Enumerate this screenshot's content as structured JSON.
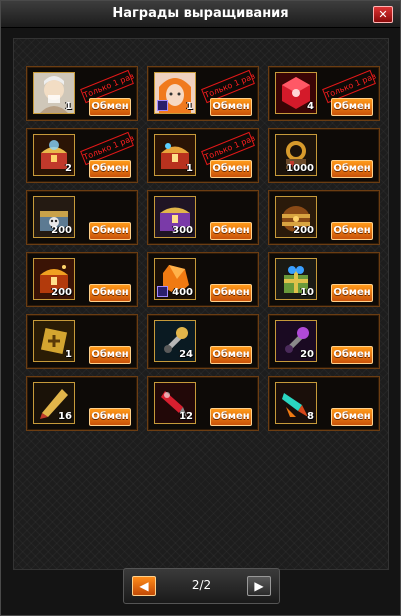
{
  "window": {
    "title": "Награды выращивания",
    "close_label": "✕"
  },
  "exchange_label": "Обмен",
  "once_label": "Только 1 раз",
  "rewards": [
    {
      "icon": "elder-portrait-icon",
      "qty": "1",
      "once": true
    },
    {
      "icon": "orange-hair-portrait-icon",
      "qty": "1",
      "once": true
    },
    {
      "icon": "red-cube-icon",
      "qty": "4",
      "once": true
    },
    {
      "icon": "gold-chest-icon",
      "qty": "2",
      "once": true
    },
    {
      "icon": "treasure-chest-icon",
      "qty": "1",
      "once": true
    },
    {
      "icon": "gear-bundle-icon",
      "qty": "1000",
      "once": false
    },
    {
      "icon": "skull-chest-icon",
      "qty": "200",
      "once": false
    },
    {
      "icon": "purple-chest-icon",
      "qty": "300",
      "once": false
    },
    {
      "icon": "barrel-icon",
      "qty": "200",
      "once": false
    },
    {
      "icon": "red-gold-chest-icon",
      "qty": "200",
      "once": false
    },
    {
      "icon": "orange-crystal-icon",
      "qty": "400",
      "once": false
    },
    {
      "icon": "gift-box-icon",
      "qty": "10",
      "once": false
    },
    {
      "icon": "gold-rune-icon",
      "qty": "1",
      "once": false
    },
    {
      "icon": "gold-key-icon",
      "qty": "24",
      "once": false
    },
    {
      "icon": "purple-key-icon",
      "qty": "20",
      "once": false
    },
    {
      "icon": "gold-shard-icon",
      "qty": "16",
      "once": false
    },
    {
      "icon": "red-shard-icon",
      "qty": "12",
      "once": false
    },
    {
      "icon": "cyan-shard-icon",
      "qty": "8",
      "once": false
    }
  ],
  "pagination": {
    "label": "2/2",
    "prev": "◀",
    "next": "▶"
  }
}
